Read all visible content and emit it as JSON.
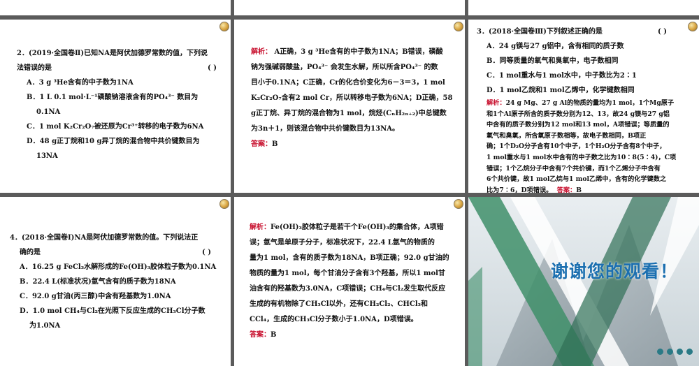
{
  "slides": {
    "top_left_strip": {},
    "top_mid_strip": {},
    "top_right_strip": {},
    "q2": {
      "line1": "2．(2019·全国卷Ⅱ)已知NA是阿伏加德罗常数的值，下列说",
      "line2": "法错误的是",
      "paren": "(      )",
      "optA": "A．3 g ³He含有的中子数为1NA",
      "optB": "B．1  L  0.1  mol·L⁻¹磷酸钠溶液含有的PO₄³⁻ 数目为",
      "optB2": "0.1NA",
      "optC": "C．1 mol K₂Cr₂O₇被还原为Cr³⁺转移的电子数为6NA",
      "optD": "D．48  g正丁烷和10  g异丁烷的混合物中共价键数目为",
      "optD2": "13NA"
    },
    "q2_analysis": {
      "label": "解析：",
      "l1": " A正确，3 g ³He含有的中子数为1NA；B错误，磷酸",
      "l2": "钠为强碱弱酸盐，PO₄³⁻ 会发生水解，所以所含PO₄³⁻ 的数",
      "l3": "目小于0.1NA；C正确，Cr的化合价变化为6－3＝3，1    mol",
      "l4": "K₂Cr₂O₇含有2 mol Cr，所以转移电子数为6NA；D正确，58",
      "l5": "g正丁烷、异丁烷的混合物为1  mol，烷烃(CₙH₂ₙ₊₂)中总键数",
      "l6": "为3n＋1，则该混合物中共价键数目为13NA。",
      "answer_label": "答案：",
      "answer": "B"
    },
    "q3": {
      "line1": "3．(2018·全国卷Ⅲ)下列叙述正确的是",
      "paren": "(      )",
      "optA": "A．24 g镁与27 g铝中，含有相同的质子数",
      "optB": "B．同等质量的氧气和臭氧中，电子数相同",
      "optC": "C．1   mol重水与1 mol水中，中子数比为2∶1",
      "optD": "D．1 mol乙烷和1 mol乙烯中，化学键数相同",
      "analysis_label": "解析：",
      "a1": "24 g Mg、27 g Al的物质的量均为1 mol，1个Mg原子",
      "a2": "和1个Al原子所含的质子数分别为12、13，故24 g镁与27 g铝",
      "a3": "中含有的质子数分别为12 mol和13 mol，A项错误；等质量的",
      "a4": "氧气和臭氧，所含氧原子数相等，故电子数相同，B项正",
      "a5": "确；1个D₂O分子含有10个中子，1个H₂O分子含有8个中子，",
      "a6": "1 mol重水与1 mol水中含有的中子数之比为10∶8(5∶4)，C项",
      "a7": "错误；1个乙烷分子中含有7个共价键，而1个乙烯分子中含有",
      "a8": "6个共价键，故1 mol乙烷与1 mol乙烯中，含有的化学键数之",
      "a9": "比为7∶6，D项错误。",
      "answer_label": "答案：",
      "answer": "B"
    },
    "q4": {
      "line1": "4．(2018·全国卷Ⅰ)NA是阿伏加德罗常数的值。下列说法正",
      "line2": "确的是",
      "paren": "(      )",
      "optA": "A．16.25 g FeCl₃水解形成的Fe(OH)₃胶体粒子数为0.1NA",
      "optB": "B．22.4 L(标准状况)氩气含有的质子数为18NA",
      "optC": "C．92.0 g甘油(丙三醇)中含有羟基数为1.0NA",
      "optD": "D．1.0   mol   CH₄与Cl₂在光照下反应生成的CH₃Cl分子数",
      "optD2": "为1.0NA"
    },
    "q4_analysis": {
      "label": "解析：",
      "l1": "Fe(OH)₃胶体粒子是若干个Fe(OH)₃的集合体，A项错",
      "l2": "误；氩气是单原子分子，标准状况下，22.4   L氩气的物质的",
      "l3": "量为1 mol，含有的质子数为18NA，B项正确；92.0 g甘油的",
      "l4": "物质的量为1 mol，每个甘油分子含有3个羟基，所以1 mol甘",
      "l5": "油含有的羟基数为3.0NA，C项错误；CH₄与Cl₂发生取代反应",
      "l6": "生成的有机物除了CH₃Cl以外，还有CH₂Cl₂、CHCl₃和",
      "l7": "CCl₄，生成的CH₃Cl分子数小于1.0NA，D项错误。",
      "answer_label": "答案：",
      "answer": "B"
    },
    "thanks": {
      "text": "谢谢您的观看！"
    }
  },
  "colors": {
    "accent_red": "#c8102e",
    "thanks_blue": "#1b6fb0",
    "stripe_green": "#3f8f6a",
    "dot_teal": "#2a7a86"
  }
}
